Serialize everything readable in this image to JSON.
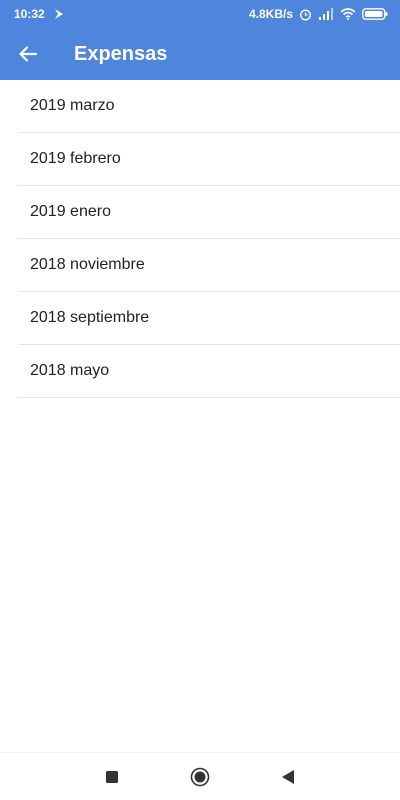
{
  "status_bar": {
    "time": "10:32",
    "network_speed": "4.8KB/s",
    "icons": [
      "notification-icon",
      "alarm-icon",
      "signal-icon",
      "wifi-icon",
      "battery-icon"
    ]
  },
  "toolbar": {
    "title": "Expensas",
    "back_icon": "arrow-back-icon"
  },
  "list": {
    "items": [
      {
        "label": "2019 marzo"
      },
      {
        "label": "2019 febrero"
      },
      {
        "label": "2019 enero"
      },
      {
        "label": "2018 noviembre"
      },
      {
        "label": "2018 septiembre"
      },
      {
        "label": "2018 mayo"
      }
    ]
  },
  "nav_bar": {
    "buttons": [
      "recents-icon",
      "home-icon",
      "back-icon"
    ]
  },
  "colors": {
    "primary": "#4e86de",
    "divider": "#e3e3e3",
    "text": "#222222",
    "background": "#ffffff"
  }
}
